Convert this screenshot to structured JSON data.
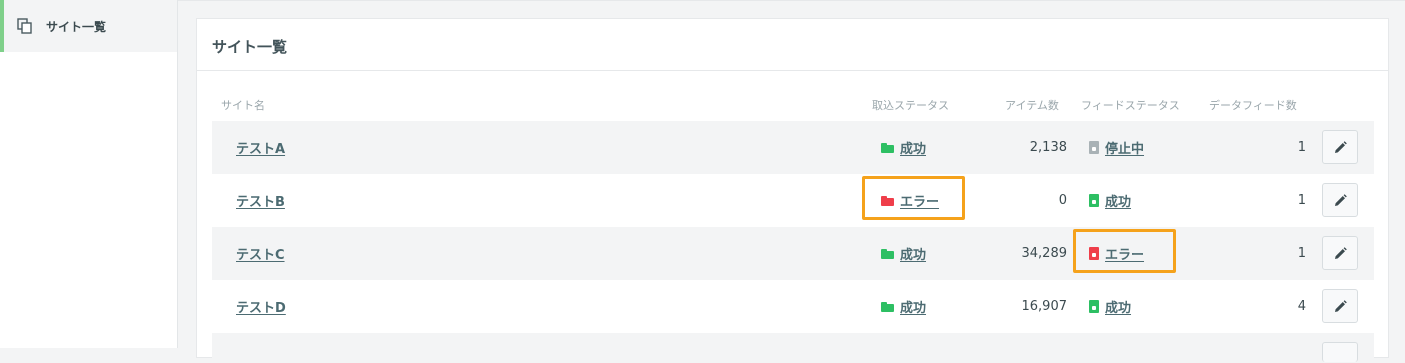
{
  "sidebar": {
    "items": [
      {
        "label": "サイト一覧",
        "icon": "copy-icon"
      }
    ]
  },
  "card": {
    "title": "サイト一覧"
  },
  "table": {
    "headers": {
      "site_name": "サイト名",
      "import_status": "取込ステータス",
      "item_count": "アイテム数",
      "feed_status": "フィードステータス",
      "data_feed_count": "データフィード数"
    },
    "rows": [
      {
        "site": "テストA",
        "import_status": "成功",
        "import_state": "success",
        "items": "2,138",
        "feed_status": "停止中",
        "feed_state": "stopped",
        "feeds": "1"
      },
      {
        "site": "テストB",
        "import_status": "エラー",
        "import_state": "error",
        "items": "0",
        "feed_status": "成功",
        "feed_state": "success",
        "feeds": "1"
      },
      {
        "site": "テストC",
        "import_status": "成功",
        "import_state": "success",
        "items": "34,289",
        "feed_status": "エラー",
        "feed_state": "error",
        "feeds": "1"
      },
      {
        "site": "テストD",
        "import_status": "成功",
        "import_state": "success",
        "items": "16,907",
        "feed_status": "成功",
        "feed_state": "success",
        "feeds": "4"
      }
    ]
  },
  "colors": {
    "success": "#2dbf63",
    "error": "#ef3e4a",
    "stopped": "#a9b2b6",
    "highlight": "#f5a21b",
    "sidebar_accent": "#7fd08a"
  }
}
